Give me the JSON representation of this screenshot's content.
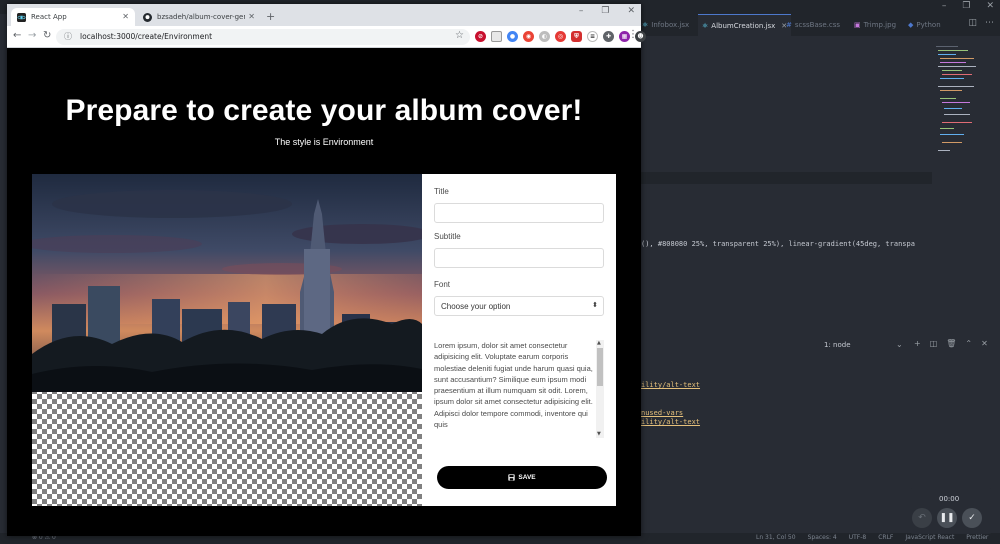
{
  "browser": {
    "tabs": [
      {
        "title": "React App",
        "active": true
      },
      {
        "title": "bzsadeh/album-cover-generator",
        "active": false
      }
    ],
    "new_tab_symbol": "+",
    "url": "localhost:3000/create/Environment"
  },
  "page": {
    "title": "Prepare to create your album cover!",
    "subtitle": "The style is Environment"
  },
  "form": {
    "title_label": "Title",
    "title_value": "",
    "subtitle_label": "Subtitle",
    "subtitle_value": "",
    "font_label": "Font",
    "font_selected": "Choose your option",
    "lorem": "Lorem ipsum, dolor sit amet consectetur adipisicing elit. Voluptate earum corporis molestiae deleniti fugiat unde harum quasi quia, sunt accusantium? Similique eum ipsum modi praesentium at illum numquam sit odit. Lorem, ipsum dolor sit amet consectetur adipisicing elit. Adipisci dolor tempore commodi, inventore qui quis",
    "save_label": "SAVE"
  },
  "editor": {
    "tabs": [
      "Infobox.jsx",
      "AlbumCreation.jsx",
      "scssBase.css",
      "Trimp.jpg",
      "Python"
    ],
    "active_tab": "AlbumCreation.jsx",
    "code_line": "(), #808080 25%, transparent 25%), linear-gradient(45deg, transpa",
    "terminal_select": "1: node",
    "terminal_links": [
      "ility/alt-text",
      "nused-vars",
      "ility/alt-text"
    ],
    "status_right": [
      "Ln 31, Col 50",
      "Spaces: 4",
      "UTF-8",
      "CRLF",
      "JavaScript React",
      "Prettier"
    ]
  },
  "recorder": {
    "time": "00:00"
  },
  "colors": {
    "accent": "#4d78cc",
    "checker": "#808080"
  }
}
